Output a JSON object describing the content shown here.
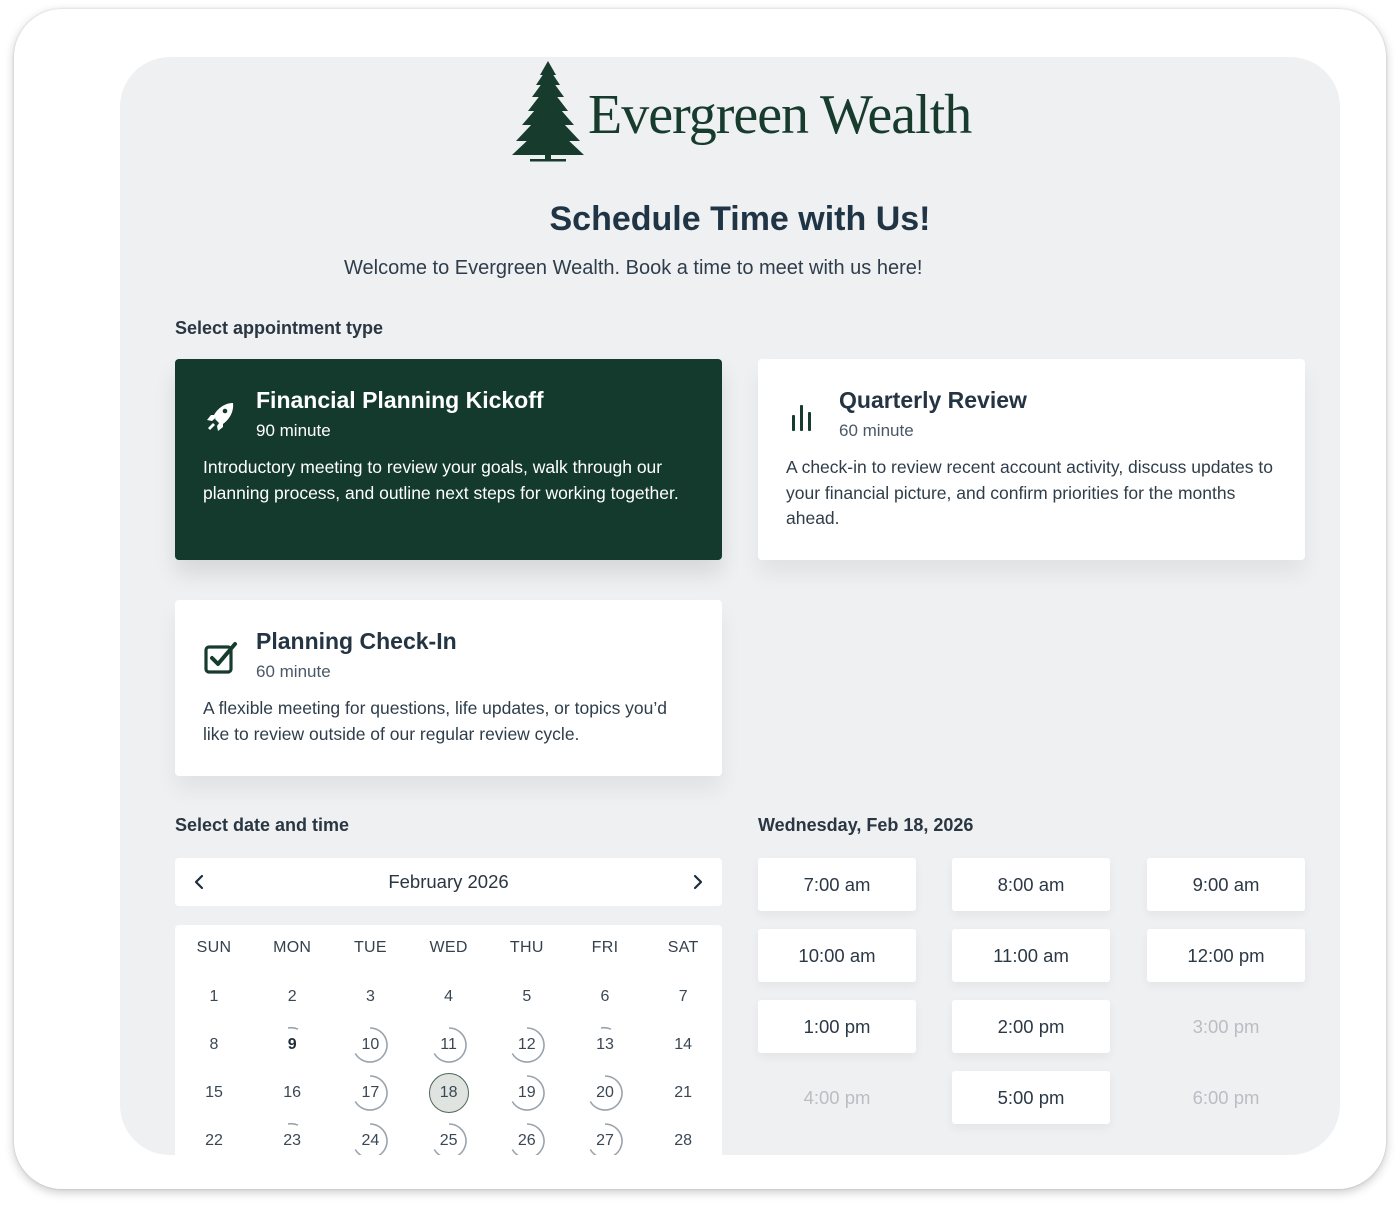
{
  "brand": {
    "name": "Evergreen Wealth",
    "color": "#173c2e"
  },
  "header": {
    "title": "Schedule Time with Us!",
    "subtitle": "Welcome to Evergreen Wealth. Book a time to meet with us here!"
  },
  "appointment_section": {
    "label": "Select appointment type",
    "types": [
      {
        "title": "Financial Planning Kickoff",
        "duration": "90 minute",
        "description": "Introductory meeting to review your goals, walk through our planning process, and outline next steps for working together.",
        "icon": "rocket-icon",
        "selected": true
      },
      {
        "title": "Quarterly Review",
        "duration": "60 minute",
        "description": "A check-in to review recent account activity, discuss updates to your financial picture, and confirm priorities for the months ahead.",
        "icon": "bar-chart-icon",
        "selected": false
      },
      {
        "title": "Planning Check-In",
        "duration": "60 minute",
        "description": "A flexible meeting for questions, life updates, or topics you’d like to review outside of our regular review cycle.",
        "icon": "checkbox-icon",
        "selected": false
      }
    ]
  },
  "date_section": {
    "label": "Select date and time",
    "month": "February 2026",
    "weekdays": [
      "SUN",
      "MON",
      "TUE",
      "WED",
      "THU",
      "FRI",
      "SAT"
    ],
    "days": [
      "1",
      "2",
      "3",
      "4",
      "5",
      "6",
      "7",
      "8",
      "9",
      "10",
      "11",
      "12",
      "13",
      "14",
      "15",
      "16",
      "17",
      "18",
      "19",
      "20",
      "21",
      "22",
      "23",
      "24",
      "25",
      "26",
      "27",
      "28"
    ],
    "selected_day": "18",
    "today": "9"
  },
  "time_section": {
    "selected_date": "Wednesday, Feb 18, 2026",
    "slots": [
      {
        "label": "7:00 am",
        "available": true
      },
      {
        "label": "8:00 am",
        "available": true
      },
      {
        "label": "9:00 am",
        "available": true
      },
      {
        "label": "10:00 am",
        "available": true
      },
      {
        "label": "11:00 am",
        "available": true
      },
      {
        "label": "12:00 pm",
        "available": true
      },
      {
        "label": "1:00 pm",
        "available": true
      },
      {
        "label": "2:00 pm",
        "available": true
      },
      {
        "label": "3:00 pm",
        "available": false
      },
      {
        "label": "4:00 pm",
        "available": false
      },
      {
        "label": "5:00 pm",
        "available": true
      },
      {
        "label": "6:00 pm",
        "available": false
      }
    ]
  },
  "colors": {
    "accent": "#143a2e",
    "panel_background": "#eff0f2",
    "text": "#1f3445",
    "disabled_text": "#b9bec4"
  }
}
